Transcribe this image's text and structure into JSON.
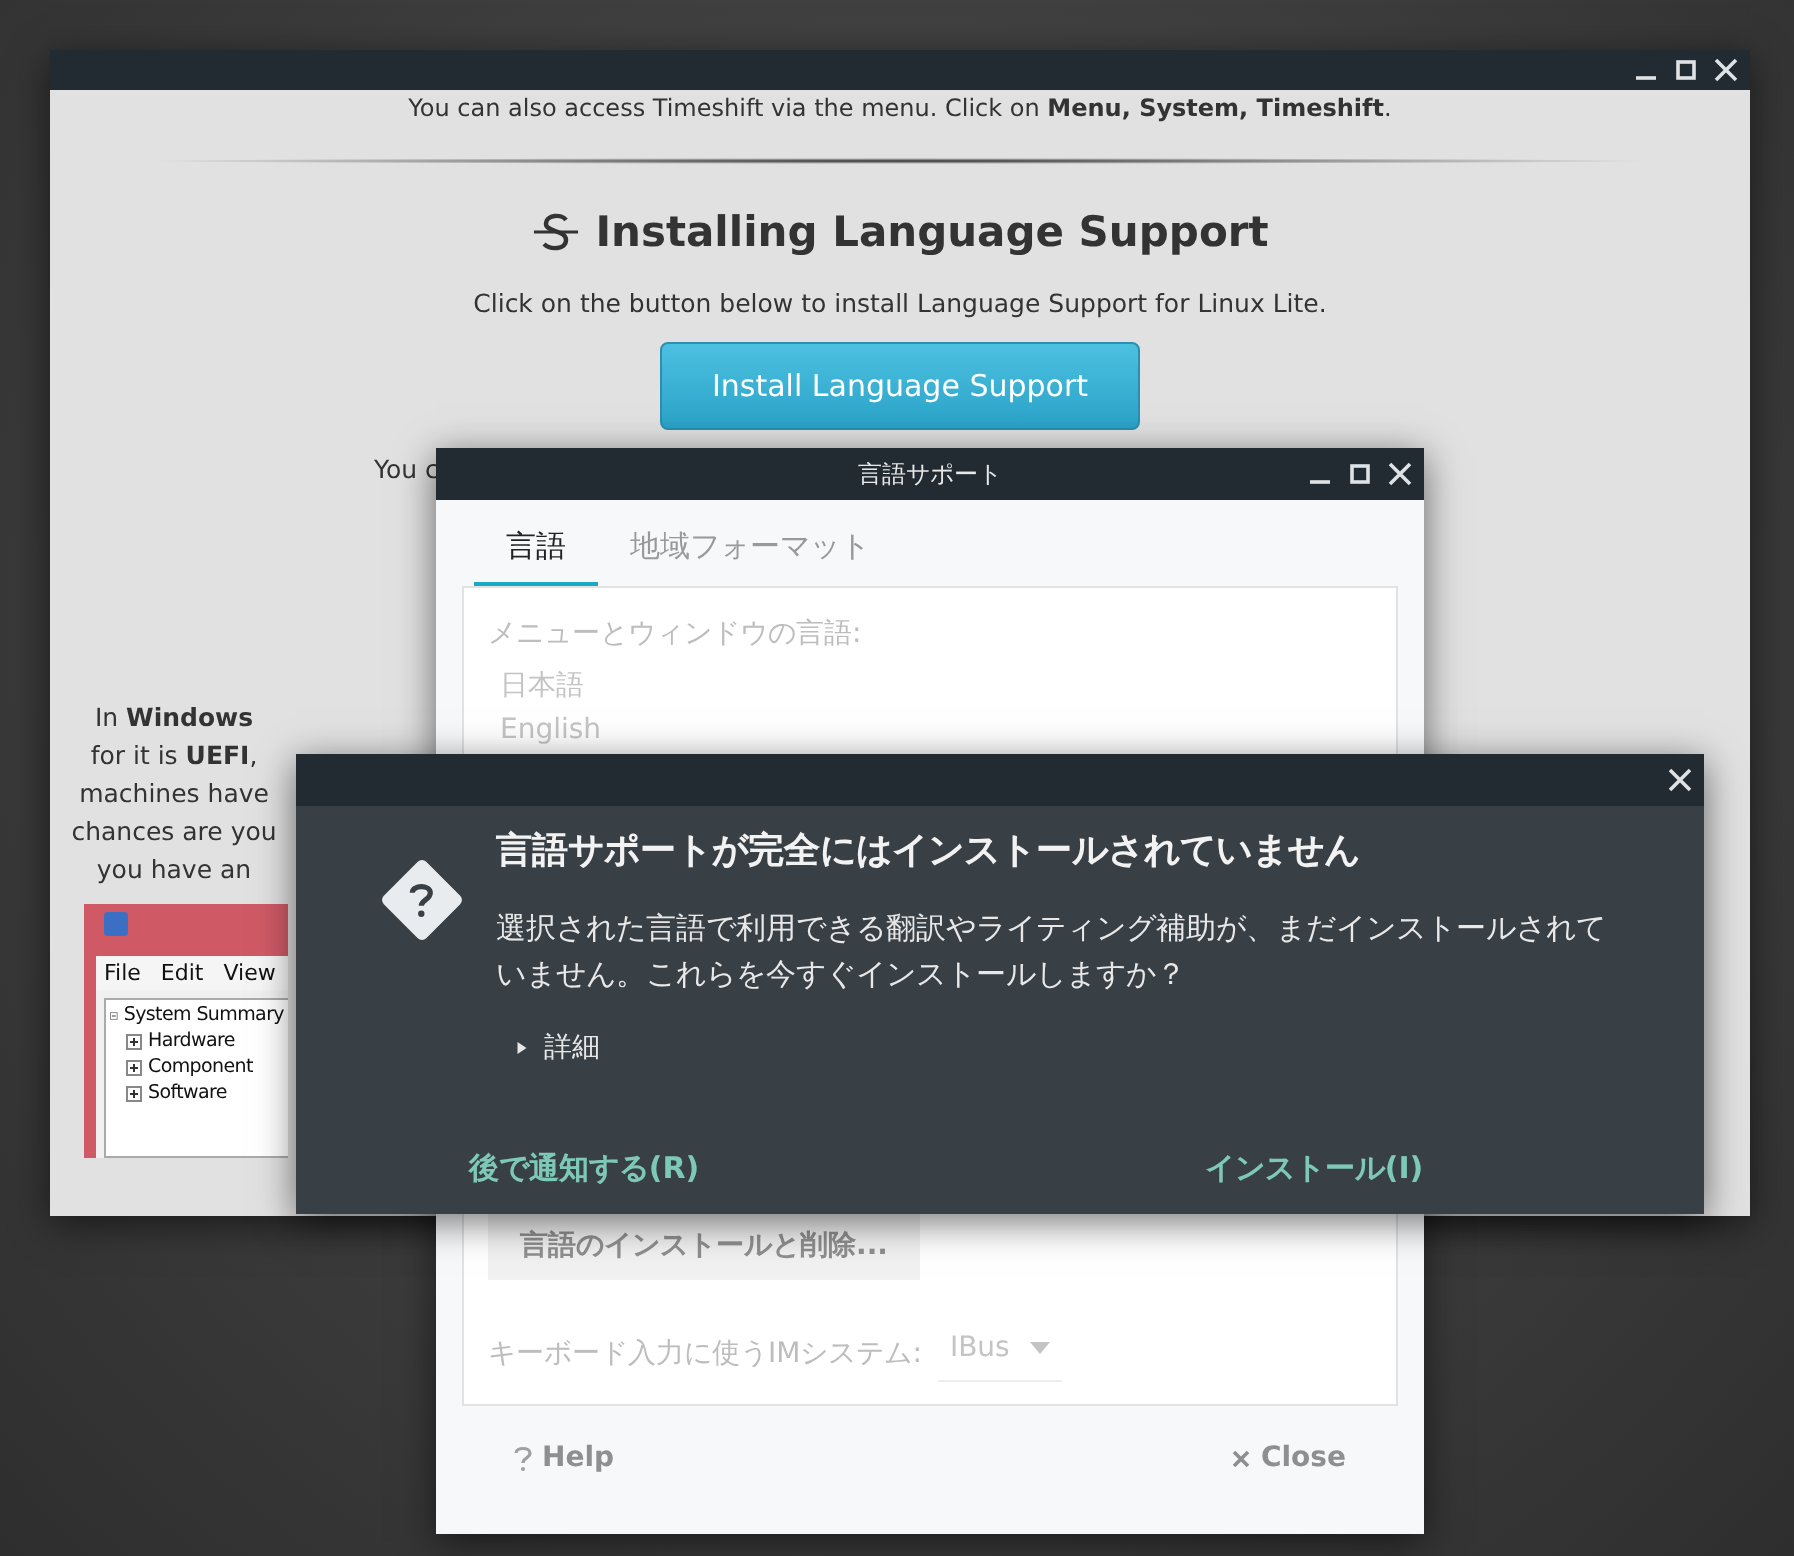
{
  "background_window": {
    "top_note": "You can also access Timeshift via the menu. Click on **Menu, System, Timeshift**.",
    "heading": "Installing Language Support",
    "intro": "Click on the button below to install Language Support for Linux Lite.",
    "install_button": "Install Language Support",
    "cut_line": "You c",
    "side_lines": [
      "In **Windows**",
      "for it is **UEFI**,",
      "machines have",
      "chances are you",
      "you have an"
    ],
    "screenshot": {
      "menu": [
        "File",
        "Edit",
        "View"
      ],
      "tree": [
        {
          "label": "System Summary",
          "expanded": true,
          "children": [
            {
              "label": "Hardware",
              "expanded": false
            },
            {
              "label": "Component",
              "expanded": false
            },
            {
              "label": "Software",
              "expanded": false
            }
          ]
        }
      ]
    }
  },
  "language_window": {
    "title": "言語サポート",
    "tabs": [
      {
        "label": "言語",
        "selected": true
      },
      {
        "label": "地域フォーマット",
        "selected": false
      }
    ],
    "language_label": "メニューとウィンドウの言語:",
    "languages": [
      "日本語",
      "English"
    ],
    "install_remove_button": "言語のインストールと削除...",
    "im_label": "キーボード入力に使うIMシステム:",
    "im_value": "IBus",
    "help_button": "Help",
    "close_button": "Close"
  },
  "dialog": {
    "heading": "言語サポートが完全にはインストールされていません",
    "body": "選択された言語で利用できる翻訳やライティング補助が、まだインストールされていません。これらを今すぐインストールしますか？",
    "details": {
      "label": "詳細",
      "expanded": false
    },
    "buttons": [
      "後で通知する(R)",
      "インストール(I)"
    ]
  }
}
